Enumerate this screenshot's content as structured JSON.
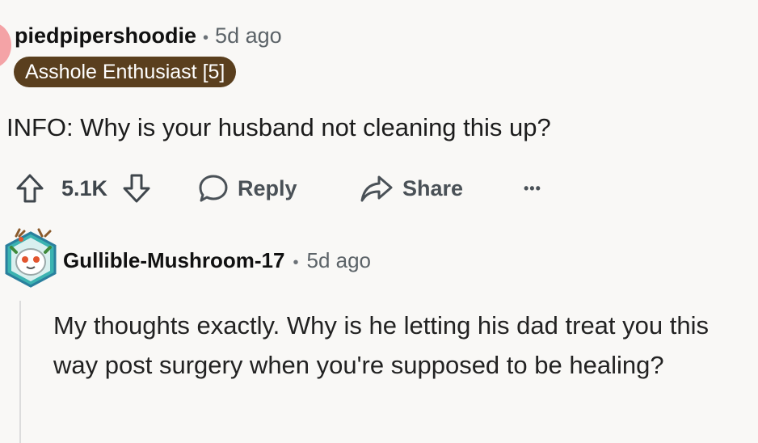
{
  "comment": {
    "author": "piedpipershoodie",
    "separator": "•",
    "time": "5d ago",
    "flair": "Asshole Enthusiast [5]",
    "body": "INFO: Why is your husband not cleaning this up?",
    "votes": "5.1K",
    "actions": {
      "reply": "Reply",
      "share": "Share",
      "more": "•••"
    }
  },
  "reply": {
    "author": "Gullible-Mushroom-17",
    "separator": "•",
    "time": "5d ago",
    "body": "My thoughts exactly. Why is he letting his dad treat you this way post surgery when you're supposed to be healing?"
  },
  "colors": {
    "background": "#f9f8f6",
    "flair_bg": "#5a3f1e",
    "avatar_peek": "#f4a3a6",
    "muted_text": "#5c6368"
  },
  "icons": {
    "upvote": "arrow-up-outline-icon",
    "downvote": "arrow-down-outline-icon",
    "reply": "speech-bubble-icon",
    "share": "share-arrow-icon",
    "more": "ellipsis-icon"
  }
}
